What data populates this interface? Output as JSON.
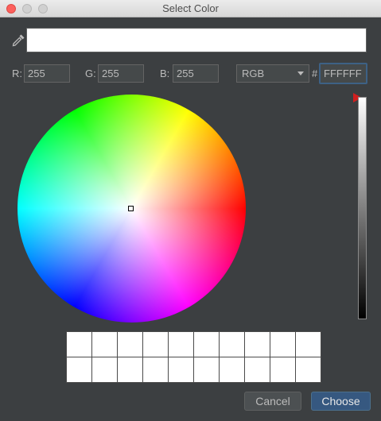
{
  "window": {
    "title": "Select Color"
  },
  "preview": {
    "color": "#ffffff"
  },
  "rgb": {
    "r_label": "R:",
    "r_value": "255",
    "g_label": "G:",
    "g_value": "255",
    "b_label": "B:",
    "b_value": "255"
  },
  "mode_select": {
    "value": "RGB"
  },
  "hex": {
    "label": "#",
    "value": "FFFFFF"
  },
  "recent_colors": [
    "#ffffff",
    "#ffffff",
    "#ffffff",
    "#ffffff",
    "#ffffff",
    "#ffffff",
    "#ffffff",
    "#ffffff",
    "#ffffff",
    "#ffffff",
    "#ffffff",
    "#ffffff",
    "#ffffff",
    "#ffffff",
    "#ffffff",
    "#ffffff",
    "#ffffff",
    "#ffffff",
    "#ffffff",
    "#ffffff"
  ],
  "buttons": {
    "cancel": "Cancel",
    "choose": "Choose"
  },
  "colors": {
    "accent": "#365880",
    "marker": "#d01f1f"
  }
}
